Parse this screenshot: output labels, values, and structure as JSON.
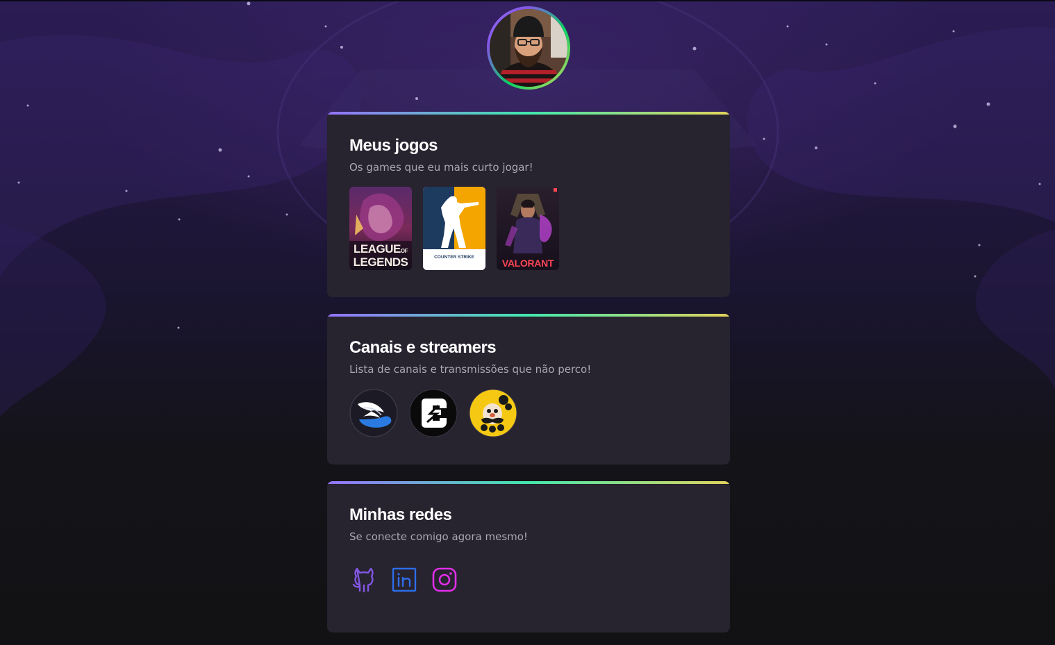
{
  "profile": {
    "avatar_alt": "avatar"
  },
  "cards": {
    "games": {
      "title": "Meus jogos",
      "subtitle": "Os games que eu mais curto jogar!",
      "items": [
        {
          "name": "League of Legends",
          "label_line1": "LEAGUE",
          "label_of": "OF",
          "label_line2": "LEGENDS"
        },
        {
          "name": "Counter-Strike",
          "label": "COUNTER STRIKE"
        },
        {
          "name": "Valorant",
          "label": "VALORANT"
        }
      ]
    },
    "channels": {
      "title": "Canais e streamers",
      "subtitle": "Lista de canais e transmissões que não perco!",
      "items": [
        {
          "name": "channel-wing"
        },
        {
          "name": "channel-e"
        },
        {
          "name": "channel-mustache"
        }
      ]
    },
    "socials": {
      "title": "Minhas redes",
      "subtitle": "Se conecte comigo agora mesmo!",
      "items": [
        {
          "name": "github",
          "icon": "github-icon",
          "color": "#8257e5"
        },
        {
          "name": "linkedin",
          "icon": "linkedin-icon",
          "color": "#2e6de8"
        },
        {
          "name": "instagram",
          "icon": "instagram-icon",
          "color": "#e22ee8"
        }
      ]
    }
  },
  "colors": {
    "background": "#121214",
    "card": "#27232f",
    "gradient_start": "#9572fc",
    "gradient_mid": "#43e7ad",
    "gradient_end": "#e2d45c"
  }
}
